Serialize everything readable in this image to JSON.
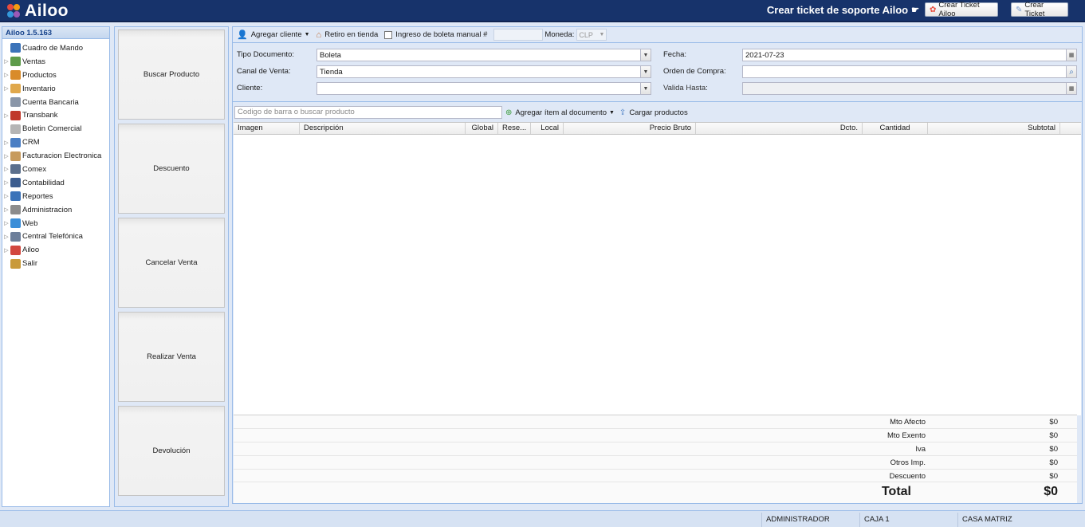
{
  "app": {
    "logo_text": "Ailoo",
    "support_title": "Crear ticket de soporte Ailoo",
    "btn_ticket_ailoo": "Crear Ticket Ailoo",
    "btn_ticket": "Crear Ticket",
    "version_title": "Ailoo 1.5.163"
  },
  "tree": [
    {
      "label": "Cuadro de Mando",
      "expandable": false,
      "icon": "chart-icon",
      "color": "#3b73b9"
    },
    {
      "label": "Ventas",
      "expandable": true,
      "icon": "money-icon",
      "color": "#5d9b4a"
    },
    {
      "label": "Productos",
      "expandable": true,
      "icon": "products-icon",
      "color": "#d98b2a"
    },
    {
      "label": "Inventario",
      "expandable": true,
      "icon": "box-icon",
      "color": "#e0a84c"
    },
    {
      "label": "Cuenta Bancaria",
      "expandable": false,
      "icon": "bank-icon",
      "color": "#8a96a8"
    },
    {
      "label": "Transbank",
      "expandable": true,
      "icon": "cross-icon",
      "color": "#c0392b"
    },
    {
      "label": "Boletin Comercial",
      "expandable": false,
      "icon": "eraser-icon",
      "color": "#b5b5b5"
    },
    {
      "label": "CRM",
      "expandable": true,
      "icon": "crm-icon",
      "color": "#4b7fc4"
    },
    {
      "label": "Facturacion Electronica",
      "expandable": true,
      "icon": "invoice-icon",
      "color": "#c79b5d"
    },
    {
      "label": "Comex",
      "expandable": true,
      "icon": "truck-icon",
      "color": "#5b6f8c"
    },
    {
      "label": "Contabilidad",
      "expandable": true,
      "icon": "ledger-icon",
      "color": "#3c5d8f"
    },
    {
      "label": "Reportes",
      "expandable": true,
      "icon": "report-icon",
      "color": "#3b73b9"
    },
    {
      "label": "Administracion",
      "expandable": true,
      "icon": "gear-icon",
      "color": "#8c8c8c"
    },
    {
      "label": "Web",
      "expandable": true,
      "icon": "globe-icon",
      "color": "#3b8ed8"
    },
    {
      "label": "Central Telefónica",
      "expandable": true,
      "icon": "phone-icon",
      "color": "#6d7f9a"
    },
    {
      "label": "Ailoo",
      "expandable": true,
      "icon": "ailoo-icon",
      "color": "#d2473f"
    },
    {
      "label": "Salir",
      "expandable": false,
      "icon": "exit-icon",
      "color": "#c99a3a"
    }
  ],
  "actions": {
    "buscar": "Buscar Producto",
    "descuento": "Descuento",
    "cancelar": "Cancelar Venta",
    "realizar": "Realizar Venta",
    "devolucion": "Devolución"
  },
  "toolbar": {
    "agregar_cliente": "Agregar cliente",
    "retiro": "Retiro en tienda",
    "ingreso_boleta": "Ingreso de boleta manual #",
    "moneda_label": "Moneda:",
    "moneda_value": "CLP"
  },
  "form": {
    "tipo_doc_label": "Tipo Documento:",
    "tipo_doc_value": "Boleta",
    "canal_label": "Canal de Venta:",
    "canal_value": "Tienda",
    "cliente_label": "Cliente:",
    "cliente_value": "",
    "fecha_label": "Fecha:",
    "fecha_value": "2021-07-23",
    "orden_label": "Orden de Compra:",
    "orden_value": "",
    "valida_label": "Valida Hasta:",
    "valida_value": ""
  },
  "product_bar": {
    "search_placeholder": "Codigo de barra o buscar producto",
    "agregar_item": "Agregar ítem al documento",
    "cargar": "Cargar productos"
  },
  "grid": {
    "columns": [
      "Imagen",
      "Descripción",
      "Global",
      "Rese...",
      "Local",
      "Precio Bruto",
      "Dcto.",
      "Cantidad",
      "Subtotal"
    ]
  },
  "totals": {
    "mto_afecto_label": "Mto Afecto",
    "mto_afecto": "$0",
    "mto_exento_label": "Mto Exento",
    "mto_exento": "$0",
    "iva_label": "Iva",
    "iva": "$0",
    "otros_label": "Otros Imp.",
    "otros": "$0",
    "descuento_label": "Descuento",
    "descuento": "$0",
    "total_label": "Total",
    "total": "$0"
  },
  "status": {
    "user": "ADMINISTRADOR",
    "caja": "CAJA 1",
    "sucursal": "CASA MATRIZ"
  }
}
